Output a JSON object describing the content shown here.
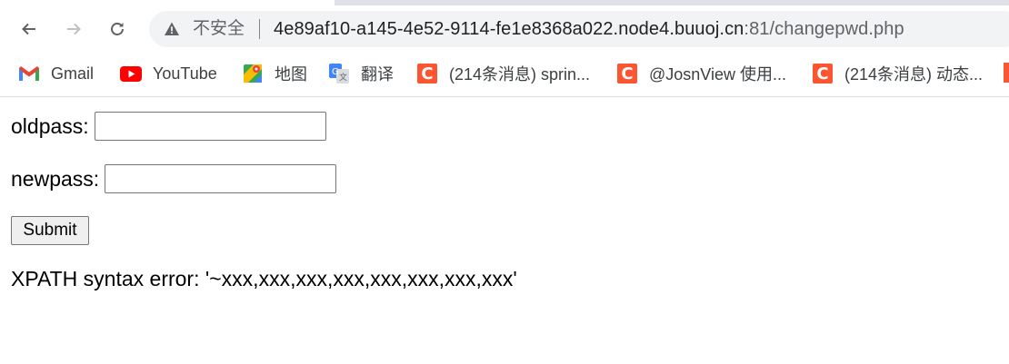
{
  "browser": {
    "security_label": "不安全",
    "url_host": "4e89af10-a145-4e52-9114-fe1e8368a022.node4.buuoj.cn",
    "url_path": ":81/changepwd.php"
  },
  "bookmarks": [
    {
      "label": "Gmail",
      "icon": "gmail-icon"
    },
    {
      "label": "YouTube",
      "icon": "youtube-icon"
    },
    {
      "label": "地图",
      "icon": "maps-icon"
    },
    {
      "label": "翻译",
      "icon": "translate-icon"
    },
    {
      "label": "(214条消息) sprin...",
      "icon": "csdn-icon"
    },
    {
      "label": "@JosnView 使用...",
      "icon": "csdn-icon"
    },
    {
      "label": "(214条消息) 动态...",
      "icon": "csdn-icon"
    }
  ],
  "form": {
    "oldpass_label": "oldpass:",
    "oldpass_value": "",
    "newpass_label": "newpass:",
    "newpass_value": "",
    "submit_label": "Submit"
  },
  "message": "XPATH syntax error: '~xxx,xxx,xxx,xxx,xxx,xxx,xxx,xxx'",
  "colors": {
    "csdn": "#fc5531",
    "youtube": "#ff0000",
    "omnibox": "#f1f3f4"
  }
}
